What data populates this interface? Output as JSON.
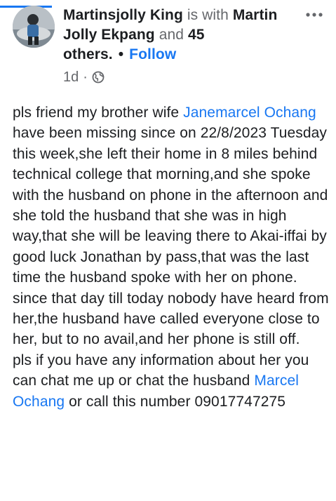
{
  "post": {
    "author": "Martinsjolly King",
    "is_with_text": "is with",
    "tagged_name": "Martin Jolly Ekpang",
    "and_text": "and",
    "others_count": "45",
    "others_label": "others.",
    "separator": "•",
    "follow_label": "Follow",
    "time": "1d",
    "meta_separator": "·",
    "audience_icon": "globe-icon",
    "more_icon": "more-horizontal-icon"
  },
  "body": {
    "p1_lead": "pls friend my brother wife ",
    "p1_mention": "Janemarcel Ochang",
    "p1_rest": " have been missing since on 22/8/2023 Tuesday this week,she left their home in 8 miles behind technical college that morning,and she spoke with the husband on phone in the afternoon and she told the husband that she was in high way,that she will be leaving there to Akai-iffai by good luck Jonathan by pass,that was the last time the husband spoke with her on phone.",
    "p2": "since that day till today nobody have heard from her,the husband have called everyone close to her, but to no avail,and her phone is still off.",
    "p3_lead": "pls if you have any information about her you can chat me up or chat the husband ",
    "p3_mention": "Marcel Ochang",
    "p3_rest": "  or call this number 09017747275"
  },
  "colors": {
    "link": "#1877f2",
    "text": "#1c1e21",
    "muted": "#65676b"
  }
}
